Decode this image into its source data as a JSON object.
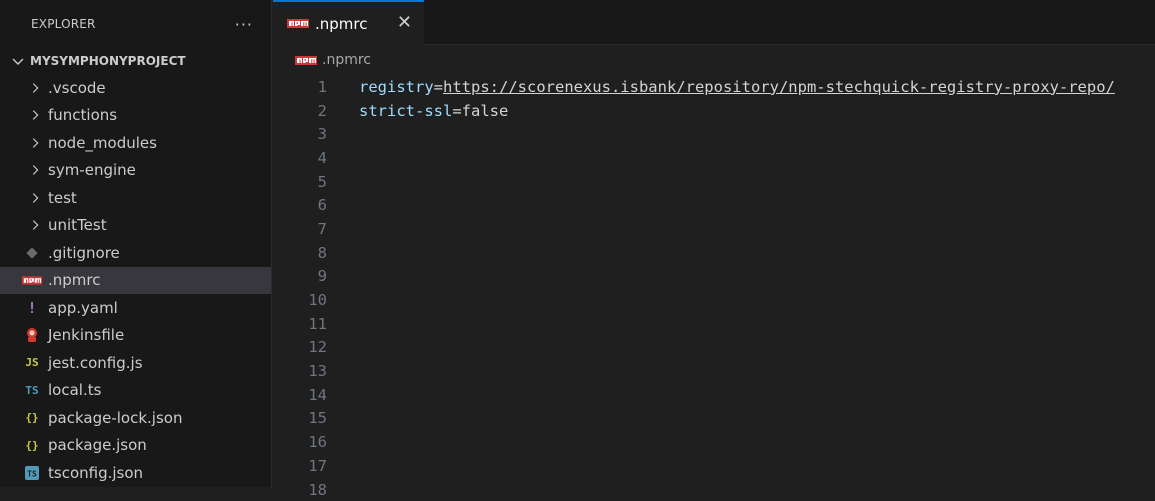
{
  "explorer": {
    "title": "EXPLORER",
    "more": "···",
    "project": "MYSYMPHONYPROJECT",
    "items": [
      {
        "type": "folder",
        "label": ".vscode"
      },
      {
        "type": "folder",
        "label": "functions"
      },
      {
        "type": "folder",
        "label": "node_modules"
      },
      {
        "type": "folder",
        "label": "sym-engine"
      },
      {
        "type": "folder",
        "label": "test"
      },
      {
        "type": "folder",
        "label": "unitTest"
      },
      {
        "type": "file",
        "label": ".gitignore",
        "icon": "git-icon"
      },
      {
        "type": "file",
        "label": ".npmrc",
        "icon": "npm-icon",
        "selected": true
      },
      {
        "type": "file",
        "label": "app.yaml",
        "icon": "yaml-icon",
        "glyph": "!"
      },
      {
        "type": "file",
        "label": "Jenkinsfile",
        "icon": "jenkins-icon"
      },
      {
        "type": "file",
        "label": "jest.config.js",
        "icon": "js-icon",
        "glyph": "JS"
      },
      {
        "type": "file",
        "label": "local.ts",
        "icon": "ts-icon",
        "glyph": "TS"
      },
      {
        "type": "file",
        "label": "package-lock.json",
        "icon": "json-icon",
        "glyph": "{}"
      },
      {
        "type": "file",
        "label": "package.json",
        "icon": "json-icon",
        "glyph": "{}"
      },
      {
        "type": "file",
        "label": "tsconfig.json",
        "icon": "tsconfig-icon",
        "glyph": "TS"
      }
    ]
  },
  "tab": {
    "label": ".npmrc",
    "close": "✕"
  },
  "breadcrumb": {
    "label": ".npmrc"
  },
  "code": {
    "line1": {
      "key": "registry",
      "eq": "=",
      "value": "https://scorenexus.isbank/repository/npm-stechquick-registry-proxy-repo/"
    },
    "line2": {
      "key": "strict-ssl",
      "eq": "=",
      "value": "false"
    },
    "line_numbers": [
      "1",
      "2",
      "3",
      "4",
      "5",
      "6",
      "7",
      "8",
      "9",
      "10",
      "11",
      "12",
      "13",
      "14",
      "15",
      "16",
      "17",
      "18"
    ]
  },
  "colors": {
    "accent": "#0078d4",
    "npm_red": "#cb3837",
    "git": "#7a7a7a",
    "yaml": "#a074c4",
    "js": "#cbcb41",
    "ts": "#519aba",
    "json": "#cbcb41",
    "jenkins": "#d33833",
    "key": "#9cdcfe"
  }
}
